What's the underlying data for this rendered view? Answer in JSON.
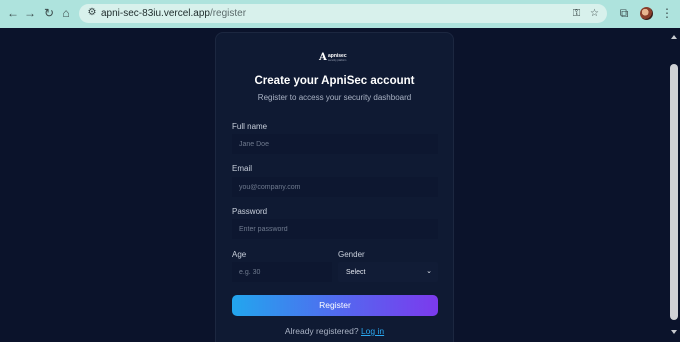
{
  "browser": {
    "url_host": "apni-sec-83iu.vercel.app",
    "url_path": "/register",
    "icons": [
      "back-icon",
      "forward-icon",
      "reload-icon",
      "home-icon",
      "site-info-icon",
      "password-key-icon",
      "bookmark-star-icon",
      "extensions-icon",
      "profile-avatar",
      "menu-icon"
    ]
  },
  "brand": {
    "logo_mark": "A",
    "logo_text": "apnisec",
    "logo_subtext": "security platform"
  },
  "form": {
    "title": "Create your ApniSec account",
    "subtitle": "Register to access your security dashboard",
    "full_name": {
      "label": "Full name",
      "placeholder": "Jane Doe"
    },
    "email": {
      "label": "Email",
      "placeholder": "you@company.com"
    },
    "password": {
      "label": "Password",
      "placeholder": "Enter password"
    },
    "age": {
      "label": "Age",
      "placeholder": "e.g. 30"
    },
    "gender": {
      "label": "Gender",
      "selected": "Select"
    },
    "submit_label": "Register",
    "footer_text": "Already registered?",
    "login_link": "Log in"
  },
  "colors": {
    "page_background": "#0b132b",
    "card_background": "#0f1a33",
    "accent_link": "#2aa8f0",
    "button_gradient_start": "#22a6ee",
    "button_gradient_end": "#7c3aed",
    "browser_chrome": "#aee3dd"
  }
}
